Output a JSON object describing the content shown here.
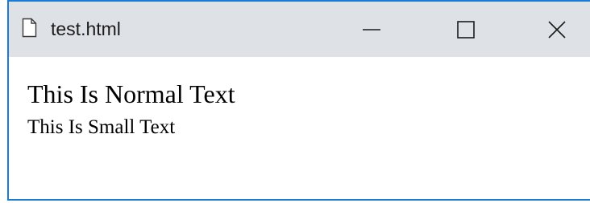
{
  "window": {
    "title": "test.html",
    "icon": "page-icon",
    "controls": {
      "minimize_icon": "minimize-icon",
      "maximize_icon": "maximize-icon",
      "close_icon": "close-icon"
    },
    "colors": {
      "titlebar_bg": "#dee1e6",
      "border_accent": "#1a7ad4",
      "content_bg": "#ffffff"
    }
  },
  "content": {
    "normal_text": "This Is Normal Text",
    "small_text": "This Is Small Text"
  }
}
